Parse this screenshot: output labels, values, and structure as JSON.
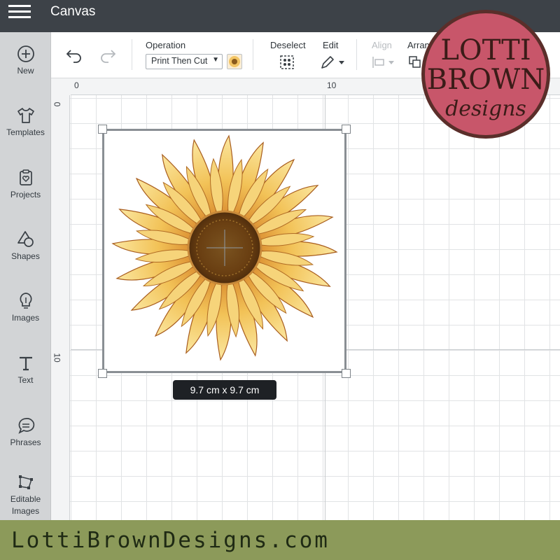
{
  "app": {
    "title": "Canvas"
  },
  "sidebar": {
    "items": [
      {
        "label": "New",
        "icon": "plus-circle-icon"
      },
      {
        "label": "Templates",
        "icon": "tshirt-icon"
      },
      {
        "label": "Projects",
        "icon": "clipboard-heart-icon"
      },
      {
        "label": "Shapes",
        "icon": "shapes-icon"
      },
      {
        "label": "Images",
        "icon": "lightbulb-icon"
      },
      {
        "label": "Text",
        "icon": "text-t-icon"
      },
      {
        "label": "Phrases",
        "icon": "speech-bubble-icon"
      },
      {
        "label": "Editable",
        "label2": "Images",
        "icon": "editable-image-icon"
      }
    ]
  },
  "toolbar": {
    "operation_label": "Operation",
    "operation_value": "Print Then Cut",
    "deselect_label": "Deselect",
    "edit_label": "Edit",
    "align_label": "Align",
    "arrange_label": "Arran"
  },
  "ruler": {
    "top": [
      "0",
      "10"
    ],
    "left": [
      "0",
      "10"
    ]
  },
  "selection": {
    "size_text": "9.7  cm x 9.7  cm"
  },
  "logo": {
    "line1": "LOTTI",
    "line2": "BROWN",
    "line3": "designs"
  },
  "banner": {
    "text": "LottiBrownDesigns.com"
  },
  "colors": {
    "topbar": "#3d4248",
    "sidebar": "#d2d4d6",
    "logo_fill": "#c8566a",
    "logo_ring": "#5a2e2a",
    "banner": "#8c9a5a"
  }
}
